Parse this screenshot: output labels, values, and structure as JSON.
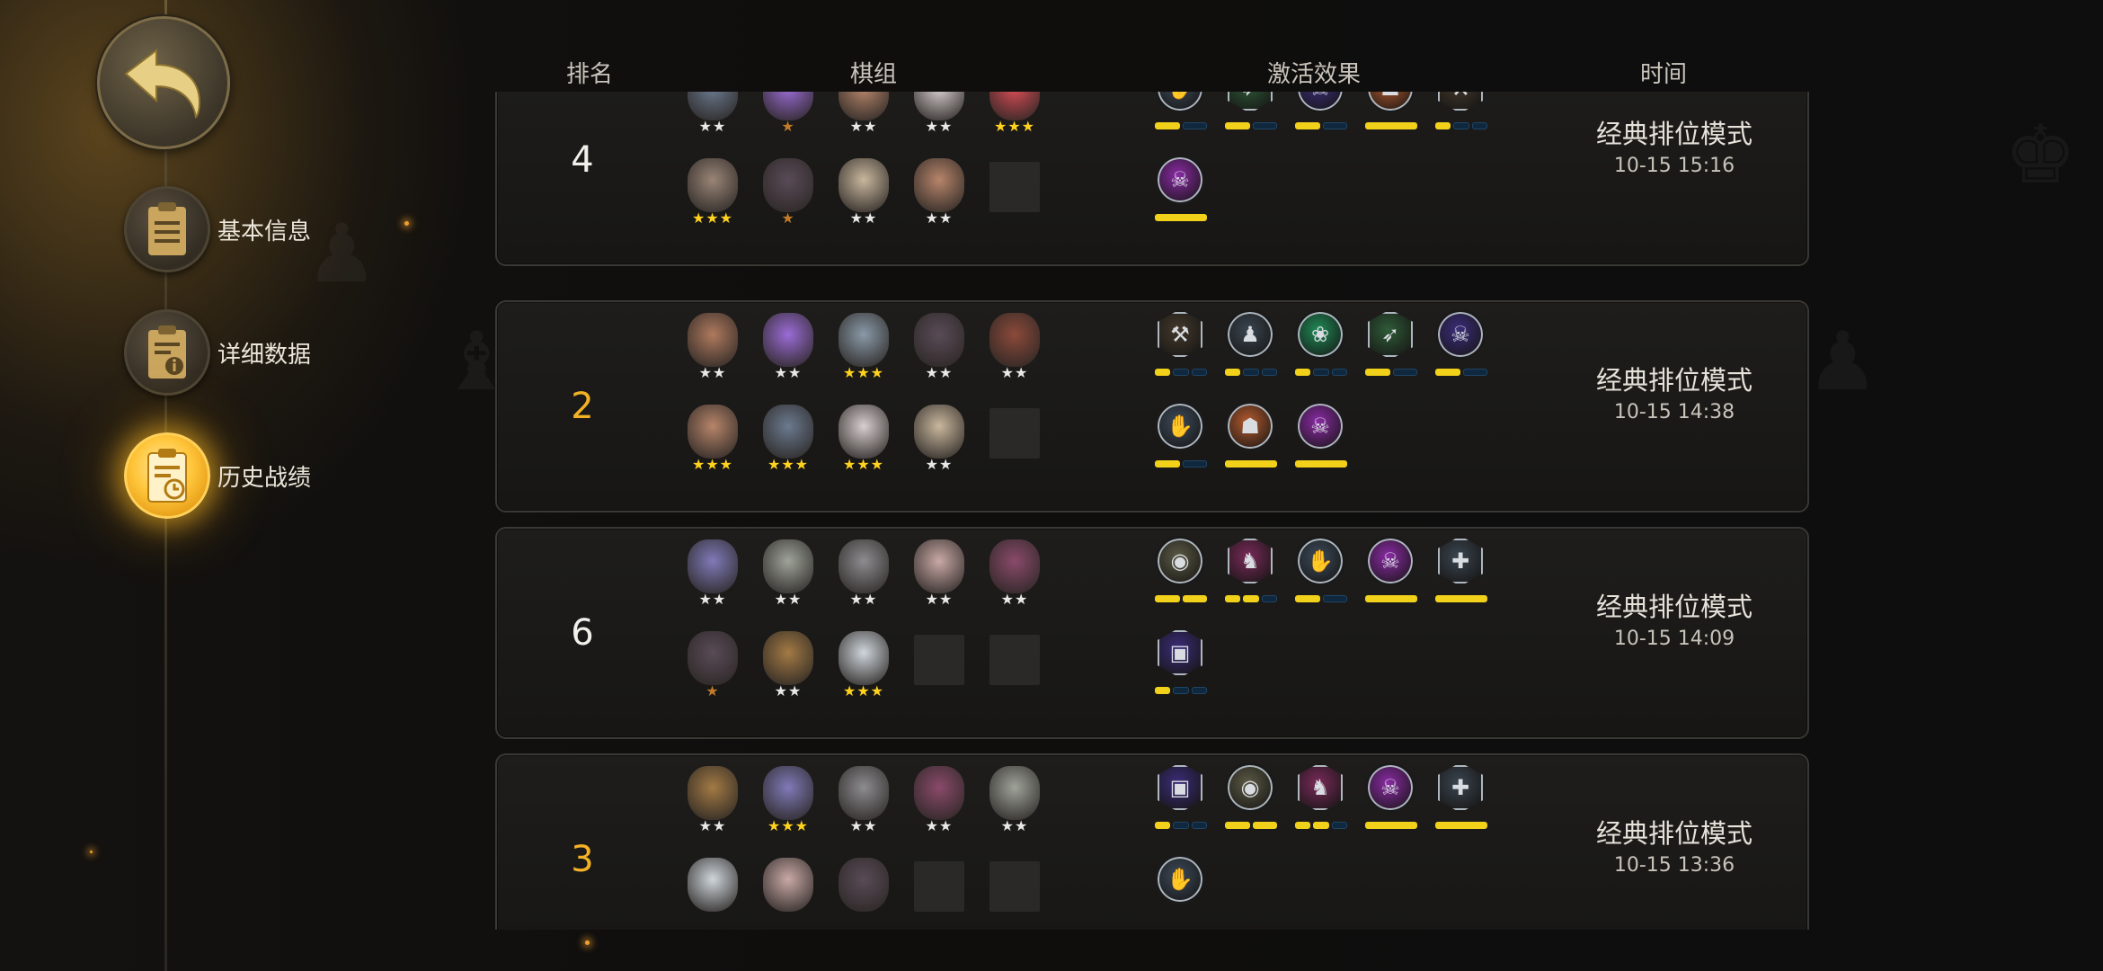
{
  "colors": {
    "accent": "#f3b225",
    "bar_on": "#f2d11a",
    "bar_off": "#10283d"
  },
  "header": {
    "rank": "排名",
    "lineup": "棋组",
    "effects": "激活效果",
    "time": "时间"
  },
  "menu": [
    {
      "label": "基本信息",
      "icon": "clipboard-icon",
      "active": false
    },
    {
      "label": "详细数据",
      "icon": "clipboard-info-icon",
      "active": false
    },
    {
      "label": "历史战绩",
      "icon": "clipboard-clock-icon",
      "active": true
    }
  ],
  "matches": [
    {
      "rank": "4",
      "highlight": false,
      "mode": "经典排位模式",
      "time": "10-15 15:16",
      "heroes": [
        {
          "name": "hooded-assassin",
          "stars": 2,
          "tier": "w",
          "color": "#6b7a8f"
        },
        {
          "name": "purple-hair-mage",
          "stars": 1,
          "tier": "b",
          "color": "#9b6cd6"
        },
        {
          "name": "goggles-dwarf",
          "stars": 2,
          "tier": "w",
          "color": "#b7856a"
        },
        {
          "name": "fluffy-beast",
          "stars": 2,
          "tier": "w",
          "color": "#d8cfcf"
        },
        {
          "name": "red-octopus",
          "stars": 3,
          "tier": "y",
          "color": "#d84c55"
        },
        {
          "name": "white-hair-brute",
          "stars": 3,
          "tier": "y",
          "color": "#9a8577"
        },
        {
          "name": "dark-hair-swordsman",
          "stars": 1,
          "tier": "b",
          "color": "#5a4b57"
        },
        {
          "name": "red-mark-monk",
          "stars": 2,
          "tier": "w",
          "color": "#c9b79d"
        },
        {
          "name": "goggles-dwarf",
          "stars": 2,
          "tier": "w",
          "color": "#b7856a"
        },
        {
          "name": "empty",
          "stars": 0,
          "tier": "w",
          "color": ""
        }
      ],
      "synergies": [
        {
          "icon": "claw-icon",
          "shape": "circle",
          "color": "#3c4a5a",
          "glyph": "✋",
          "bars": [
            1,
            0
          ]
        },
        {
          "icon": "bow-icon",
          "shape": "hex",
          "color": "#2f5b38",
          "glyph": "➶",
          "bars": [
            1,
            0
          ]
        },
        {
          "icon": "fish-bone-icon",
          "shape": "circle",
          "color": "#3b2d7a",
          "glyph": "☠",
          "bars": [
            1,
            0
          ]
        },
        {
          "icon": "demon-icon",
          "shape": "circle",
          "color": "#b45a2e",
          "glyph": "☗",
          "bars": [
            1
          ]
        },
        {
          "icon": "axe-icon",
          "shape": "hex",
          "color": "#43392b",
          "glyph": "⚒",
          "bars": [
            1,
            0,
            0
          ]
        },
        {
          "icon": "skull-icon",
          "shape": "circle",
          "color": "#8b2aa5",
          "glyph": "☠",
          "bars": [
            1
          ]
        }
      ]
    },
    {
      "rank": "2",
      "highlight": true,
      "mode": "经典排位模式",
      "time": "10-15 14:38",
      "heroes": [
        {
          "name": "horned-dwarf",
          "stars": 2,
          "tier": "w",
          "color": "#b07a5e"
        },
        {
          "name": "purple-hair-mage",
          "stars": 2,
          "tier": "w",
          "color": "#9b6cd6"
        },
        {
          "name": "armored-beast",
          "stars": 3,
          "tier": "y",
          "color": "#8a9aa8"
        },
        {
          "name": "dark-hair-swordsman",
          "stars": 2,
          "tier": "w",
          "color": "#5a4b57"
        },
        {
          "name": "red-cap-dwarf",
          "stars": 2,
          "tier": "w",
          "color": "#8c4a3a"
        },
        {
          "name": "goggles-dwarf",
          "stars": 3,
          "tier": "y",
          "color": "#b7856a"
        },
        {
          "name": "hooded-assassin",
          "stars": 3,
          "tier": "y",
          "color": "#6b7a8f"
        },
        {
          "name": "fluffy-beast",
          "stars": 3,
          "tier": "y",
          "color": "#d8cfcf"
        },
        {
          "name": "red-mark-monk",
          "stars": 2,
          "tier": "w",
          "color": "#c9b79d"
        },
        {
          "name": "empty",
          "stars": 0,
          "tier": "w",
          "color": ""
        }
      ],
      "synergies": [
        {
          "icon": "axe-icon",
          "shape": "hex",
          "color": "#43392b",
          "glyph": "⚒",
          "bars": [
            1,
            0,
            0
          ]
        },
        {
          "icon": "pawn-icon",
          "shape": "circle",
          "color": "#3a4550",
          "glyph": "♟",
          "bars": [
            1,
            0,
            0
          ]
        },
        {
          "icon": "paw-icon",
          "shape": "circle",
          "color": "#1f8a56",
          "glyph": "❀",
          "bars": [
            1,
            0,
            0
          ]
        },
        {
          "icon": "bow-icon",
          "shape": "hex",
          "color": "#2f5b38",
          "glyph": "➶",
          "bars": [
            1,
            0
          ]
        },
        {
          "icon": "fish-bone-icon",
          "shape": "circle",
          "color": "#3b2d7a",
          "glyph": "☠",
          "bars": [
            1,
            0
          ]
        },
        {
          "icon": "claw-icon",
          "shape": "circle",
          "color": "#3c4a5a",
          "glyph": "✋",
          "bars": [
            1,
            0
          ]
        },
        {
          "icon": "demon-icon",
          "shape": "circle",
          "color": "#b45a2e",
          "glyph": "☗",
          "bars": [
            1
          ]
        },
        {
          "icon": "skull-icon",
          "shape": "circle",
          "color": "#8b2aa5",
          "glyph": "☠",
          "bars": [
            1
          ]
        }
      ]
    },
    {
      "rank": "6",
      "highlight": false,
      "mode": "经典排位模式",
      "time": "10-15 14:09",
      "heroes": [
        {
          "name": "bat-demon",
          "stars": 2,
          "tier": "w",
          "color": "#7f7ab8"
        },
        {
          "name": "mecha-golem",
          "stars": 2,
          "tier": "w",
          "color": "#9fa39a"
        },
        {
          "name": "horned-ogre",
          "stars": 2,
          "tier": "w",
          "color": "#8d8c8f"
        },
        {
          "name": "white-hair-knight",
          "stars": 2,
          "tier": "w",
          "color": "#c9a9a6"
        },
        {
          "name": "horned-tauren",
          "stars": 2,
          "tier": "w",
          "color": "#8a4a6a"
        },
        {
          "name": "dark-hair-swordsman",
          "stars": 1,
          "tier": "b",
          "color": "#5a4b57"
        },
        {
          "name": "tree-golem",
          "stars": 2,
          "tier": "w",
          "color": "#a37a44"
        },
        {
          "name": "frost-yeti",
          "stars": 3,
          "tier": "y",
          "color": "#cfd6dc"
        },
        {
          "name": "empty",
          "stars": 0,
          "tier": "w",
          "color": ""
        },
        {
          "name": "empty",
          "stars": 0,
          "tier": "w",
          "color": ""
        }
      ],
      "synergies": [
        {
          "icon": "egg-icon",
          "shape": "circle",
          "color": "#5b5a45",
          "glyph": "◉",
          "bars": [
            1,
            1
          ]
        },
        {
          "icon": "knight-icon",
          "shape": "hex",
          "color": "#7a2a5a",
          "glyph": "♞",
          "bars": [
            1,
            1,
            0
          ]
        },
        {
          "icon": "claw-icon",
          "shape": "circle",
          "color": "#3c4a5a",
          "glyph": "✋",
          "bars": [
            1,
            0
          ]
        },
        {
          "icon": "skull-icon",
          "shape": "circle",
          "color": "#8b2aa5",
          "glyph": "☠",
          "bars": [
            1
          ]
        },
        {
          "icon": "cross-icon",
          "shape": "hex",
          "color": "#3a4550",
          "glyph": "✚",
          "bars": [
            1
          ]
        },
        {
          "icon": "mech-icon",
          "shape": "hex",
          "color": "#3b2d7a",
          "glyph": "▣",
          "bars": [
            1,
            0,
            0
          ]
        }
      ]
    },
    {
      "rank": "3",
      "highlight": true,
      "mode": "经典排位模式",
      "time": "10-15 13:36",
      "heroes": [
        {
          "name": "tree-golem",
          "stars": 2,
          "tier": "w",
          "color": "#a37a44"
        },
        {
          "name": "bat-demon",
          "stars": 3,
          "tier": "y",
          "color": "#7f7ab8"
        },
        {
          "name": "horned-ogre",
          "stars": 2,
          "tier": "w",
          "color": "#8d8c8f"
        },
        {
          "name": "horned-tauren",
          "stars": 2,
          "tier": "w",
          "color": "#8a4a6a"
        },
        {
          "name": "mecha-golem",
          "stars": 2,
          "tier": "w",
          "color": "#9fa39a"
        },
        {
          "name": "frost-yeti",
          "stars": 0,
          "tier": "w",
          "color": "#cfd6dc"
        },
        {
          "name": "white-hair-knight",
          "stars": 0,
          "tier": "w",
          "color": "#c9a9a6"
        },
        {
          "name": "dark-hair-swordsman",
          "stars": 0,
          "tier": "w",
          "color": "#5a4b57"
        },
        {
          "name": "empty",
          "stars": 0,
          "tier": "w",
          "color": ""
        },
        {
          "name": "empty",
          "stars": 0,
          "tier": "w",
          "color": ""
        }
      ],
      "synergies": [
        {
          "icon": "mech-icon",
          "shape": "hex",
          "color": "#3b2d7a",
          "glyph": "▣",
          "bars": [
            1,
            0,
            0
          ]
        },
        {
          "icon": "egg-icon",
          "shape": "circle",
          "color": "#5b5a45",
          "glyph": "◉",
          "bars": [
            1,
            1
          ]
        },
        {
          "icon": "knight-icon",
          "shape": "hex",
          "color": "#7a2a5a",
          "glyph": "♞",
          "bars": [
            1,
            1,
            0
          ]
        },
        {
          "icon": "skull-icon",
          "shape": "circle",
          "color": "#8b2aa5",
          "glyph": "☠",
          "bars": [
            1
          ]
        },
        {
          "icon": "cross-icon",
          "shape": "hex",
          "color": "#3a4550",
          "glyph": "✚",
          "bars": [
            1
          ]
        },
        {
          "icon": "claw-icon",
          "shape": "circle",
          "color": "#3c4a5a",
          "glyph": "✋",
          "bars": []
        }
      ]
    }
  ]
}
